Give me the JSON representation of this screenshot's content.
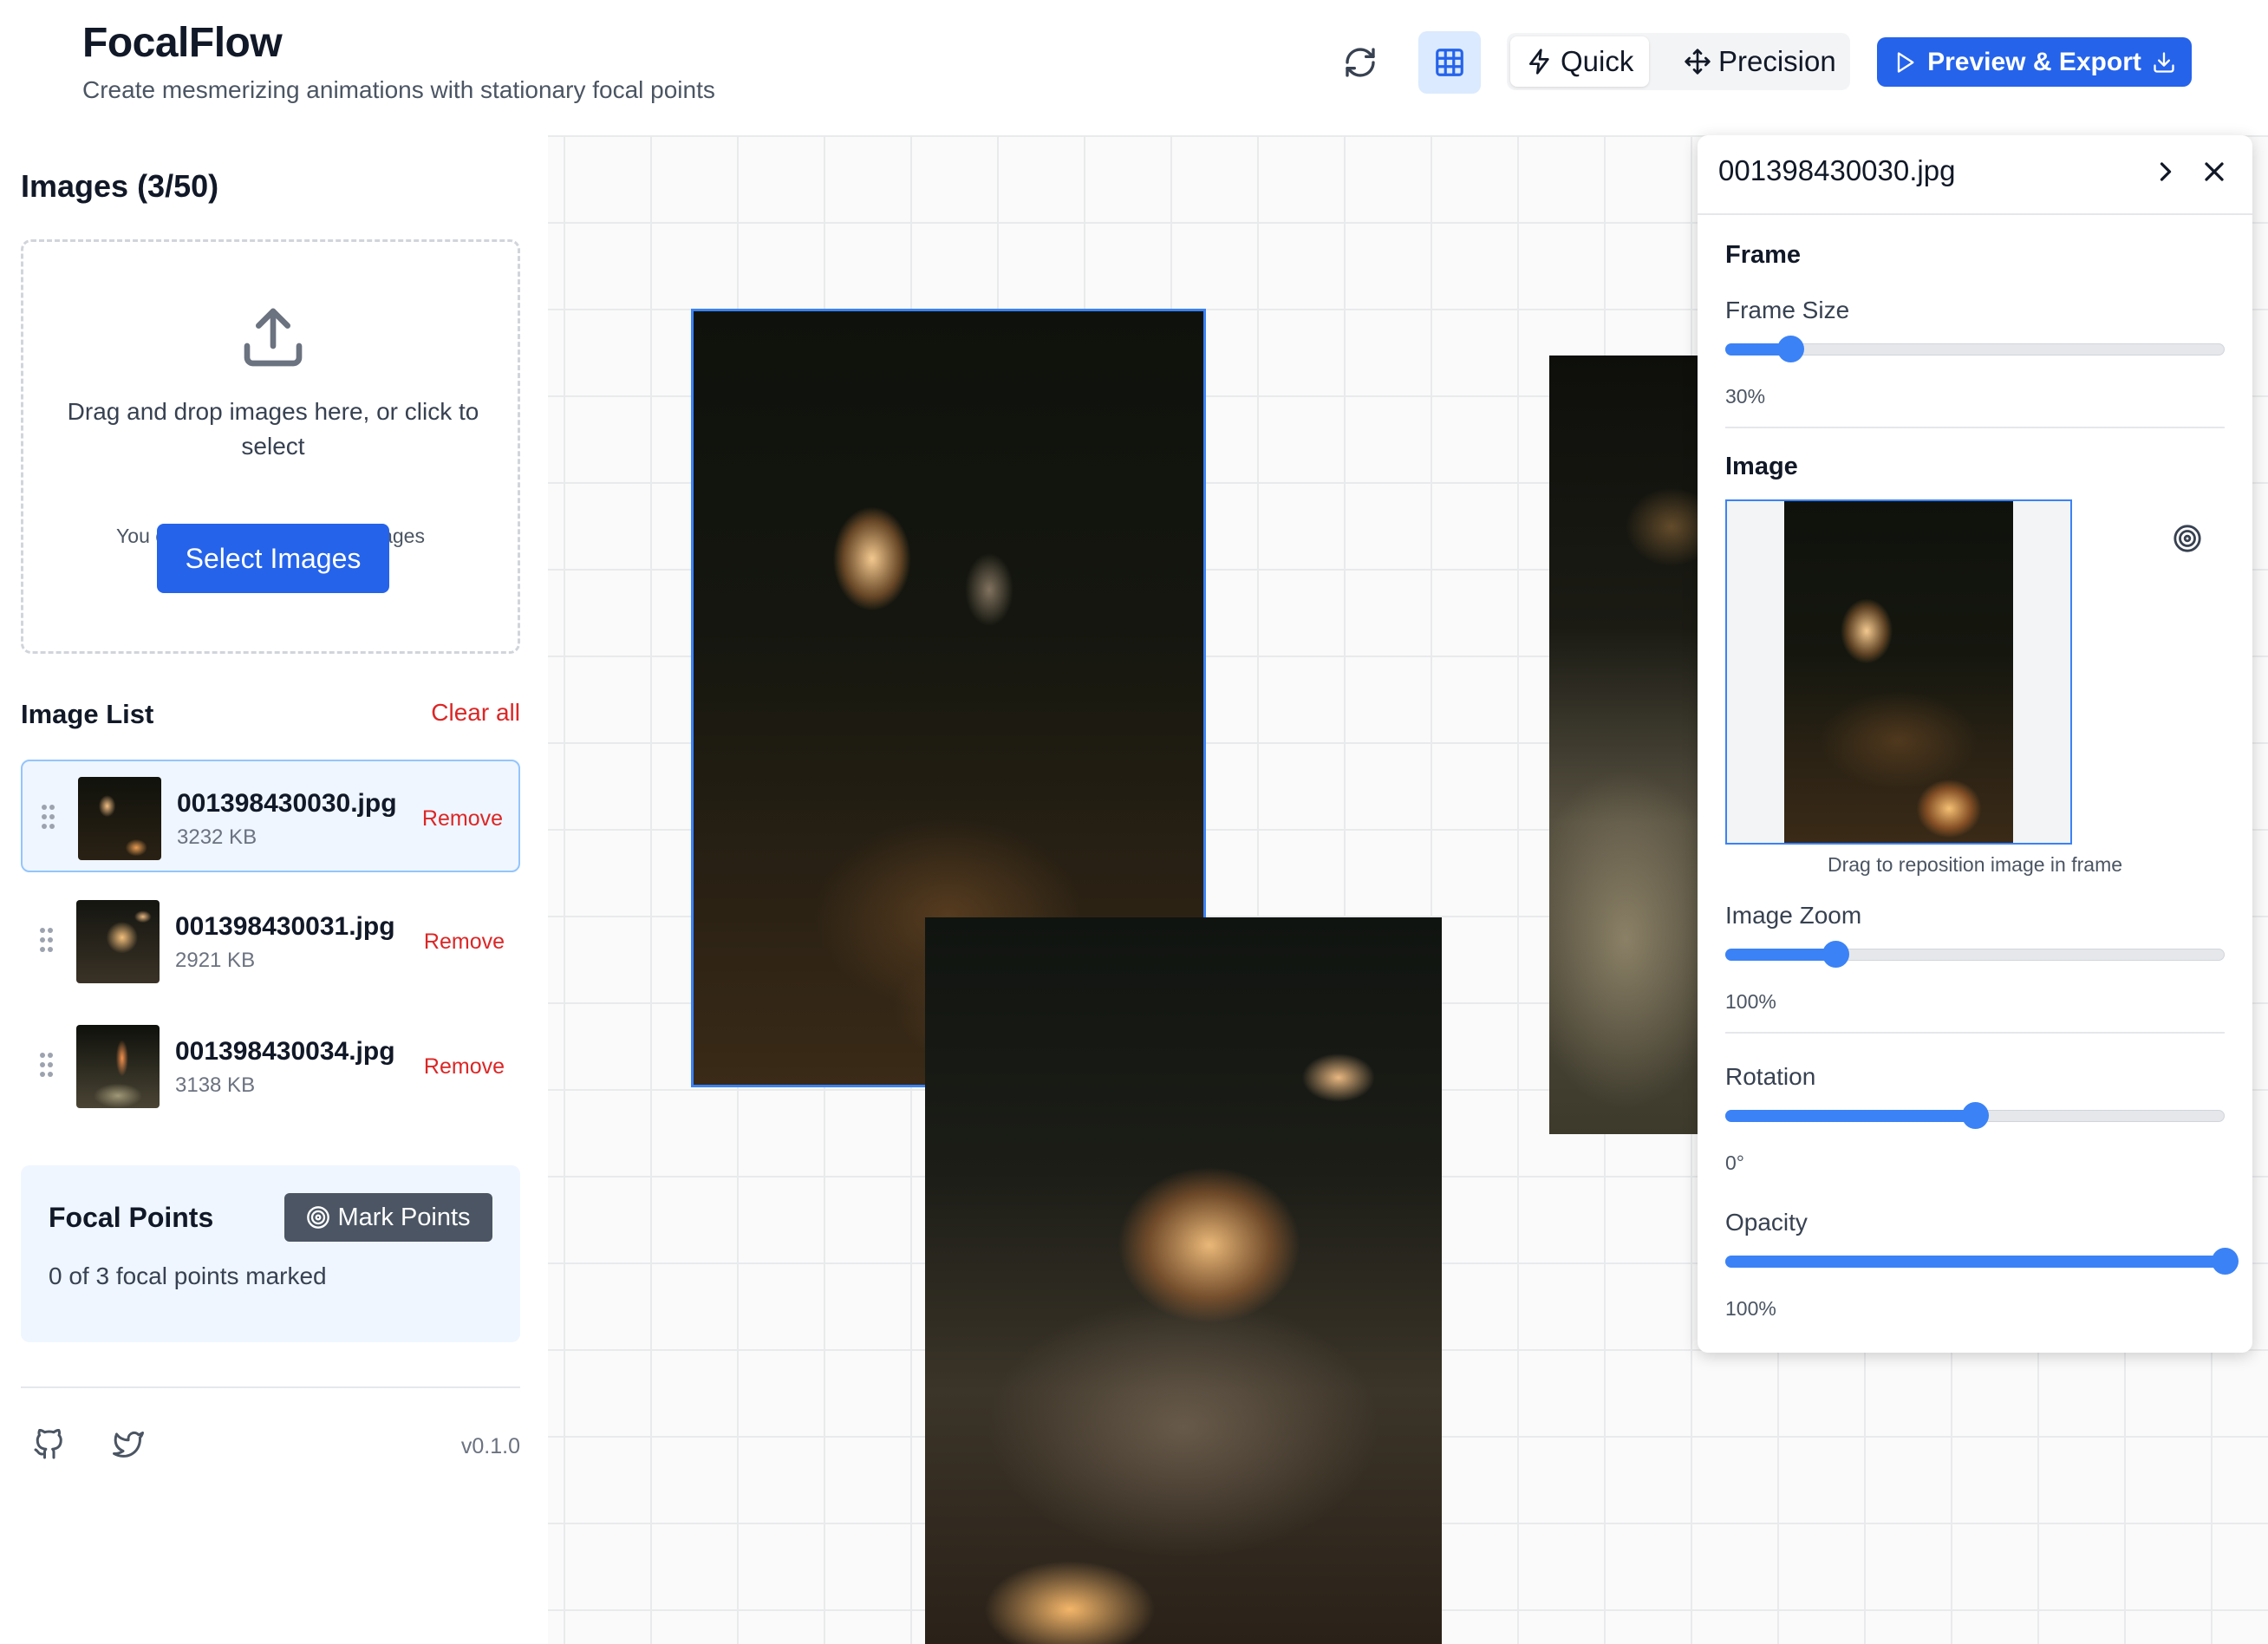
{
  "app": {
    "title": "FocalFlow",
    "subtitle": "Create mesmerizing animations with stationary focal points"
  },
  "toolbar": {
    "refresh_icon": "refresh-icon",
    "grid_icon": "grid-icon",
    "modes": [
      {
        "label": "Quick",
        "icon": "lightning-icon",
        "active": true
      },
      {
        "label": "Precision",
        "icon": "move-icon",
        "active": false
      }
    ],
    "export_label": "Preview & Export",
    "accent_color": "#2563eb"
  },
  "sidebar": {
    "images_title": "Images (3/50)",
    "dropzone": {
      "text": "Drag and drop images here, or click to select",
      "limit": "You can add up to 47 more images",
      "button": "Select Images"
    },
    "list_title": "Image List",
    "clear_all": "Clear all",
    "items": [
      {
        "name": "001398430030.jpg",
        "size": "3232 KB",
        "remove": "Remove",
        "selected": true
      },
      {
        "name": "001398430031.jpg",
        "size": "2921 KB",
        "remove": "Remove",
        "selected": false
      },
      {
        "name": "001398430034.jpg",
        "size": "3138 KB",
        "remove": "Remove",
        "selected": false
      }
    ],
    "focal": {
      "title": "Focal Points",
      "button": "Mark Points",
      "status": "0 of 3 focal points marked"
    },
    "footer": {
      "version": "v0.1.0"
    }
  },
  "panel": {
    "filename": "001398430030.jpg",
    "frame_section": "Frame",
    "frame_size_label": "Frame Size",
    "frame_size_value": "30%",
    "frame_size_fraction": 0.13,
    "image_section": "Image",
    "reposition_hint": "Drag to reposition image in frame",
    "zoom_label": "Image Zoom",
    "zoom_value": "100%",
    "zoom_fraction": 0.22,
    "rotation_label": "Rotation",
    "rotation_value": "0°",
    "rotation_fraction": 0.5,
    "opacity_label": "Opacity",
    "opacity_value": "100%",
    "opacity_fraction": 1.0
  }
}
